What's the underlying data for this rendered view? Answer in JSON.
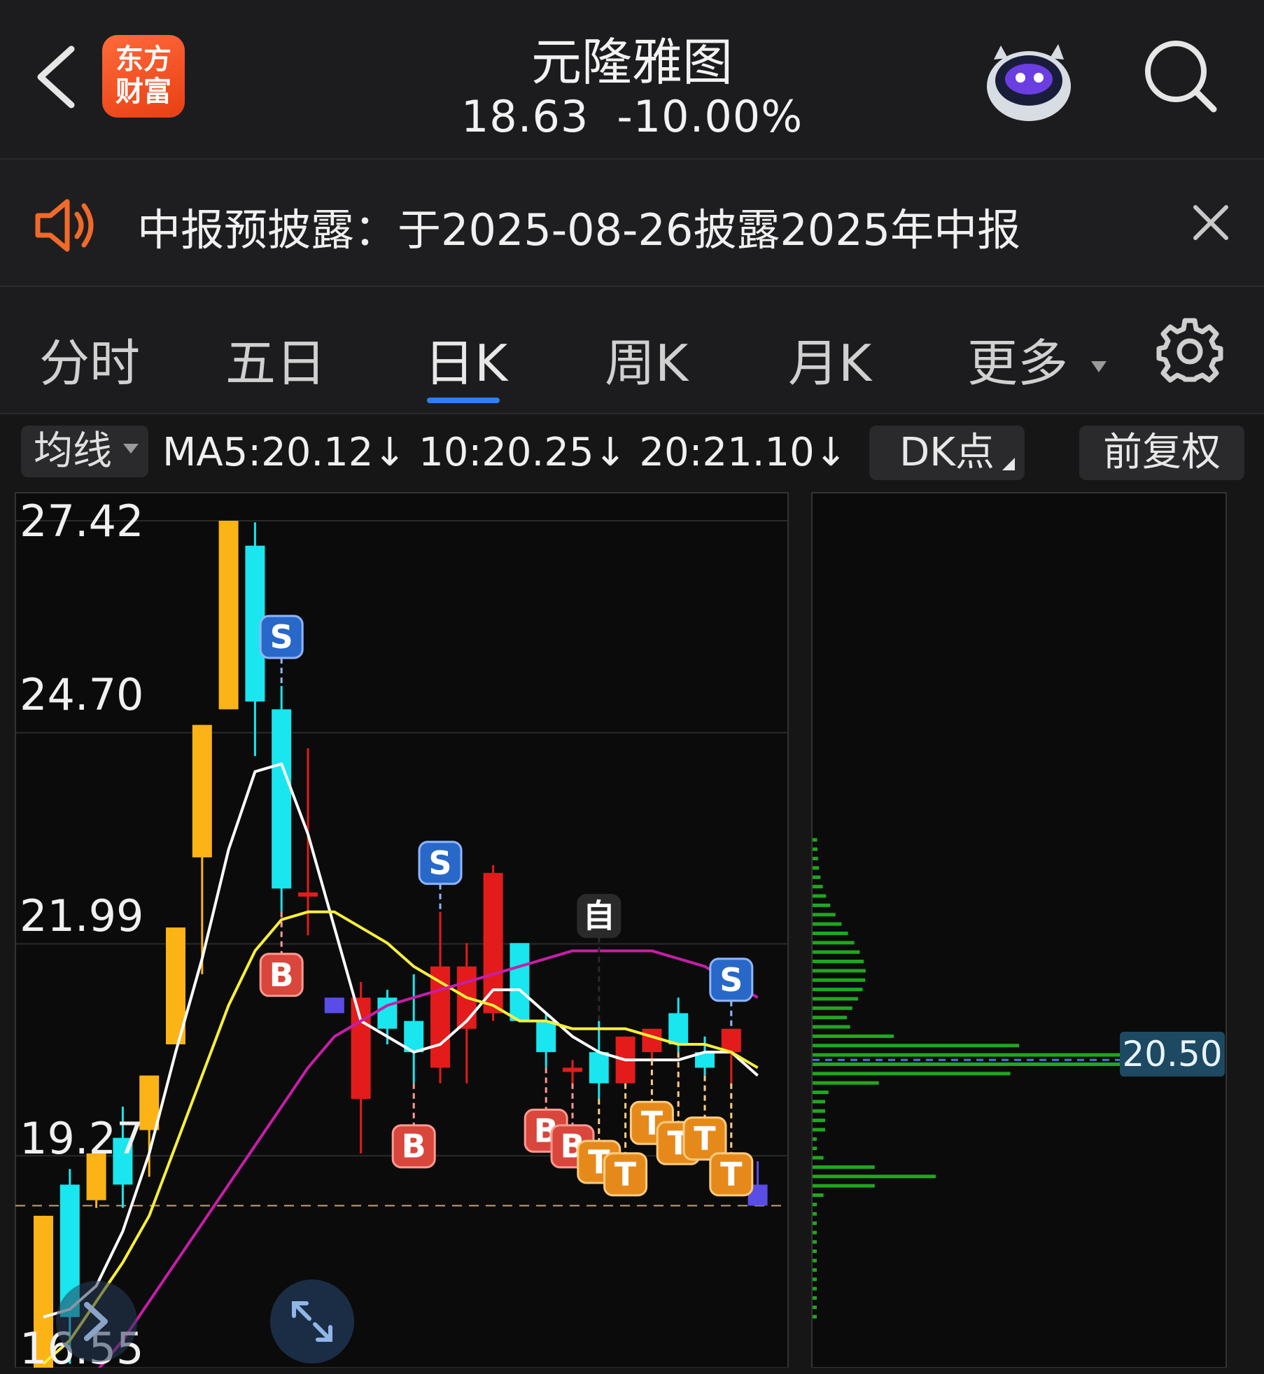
{
  "header": {
    "back_icon": "chevron-left-icon",
    "logo_line1": "东方",
    "logo_line2": "财富",
    "stock_name": "元隆雅图",
    "price": "18.63",
    "change_pct": "-10.00%",
    "mascot_icon": "robot-mascot-icon",
    "search_icon": "search-icon"
  },
  "notice": {
    "icon": "speaker-icon",
    "text": "中报预披露：于2025-08-26披露2025年中报",
    "close_icon": "close-icon"
  },
  "tabs": [
    {
      "label": "分时"
    },
    {
      "label": "五日"
    },
    {
      "label": "日K",
      "active": true
    },
    {
      "label": "周K"
    },
    {
      "label": "月K"
    },
    {
      "label": "更多"
    }
  ],
  "settings_icon": "gear-icon",
  "toolbar": {
    "ma_label": "均线",
    "ma_values": "MA5:20.12↓ 10:20.25↓ 20:21.10↓",
    "dk_label": "DK点",
    "adjust_label": "前复权"
  },
  "chart_data": {
    "type": "candlestick",
    "y_axis_labels": [
      "27.42",
      "24.70",
      "21.99",
      "19.27",
      "16.55"
    ],
    "ylim": [
      16.55,
      27.42
    ],
    "reference_price": 18.63,
    "colors": {
      "up": "#e31b1b",
      "down": "#19e6ee",
      "limit_up": "#fbb316",
      "other": "#5a4de6",
      "ma5": "#ffffff",
      "ma10": "#f6ef3b",
      "ma20": "#c61ea8",
      "volume_profile": "#1fa81e",
      "reference": "#c8a070"
    },
    "candles": [
      {
        "o": 16.4,
        "h": 18.5,
        "l": 16.0,
        "c": 18.5,
        "color": "limit_up"
      },
      {
        "o": 18.9,
        "h": 19.1,
        "l": 16.6,
        "c": 17.2,
        "color": "down"
      },
      {
        "o": 18.7,
        "h": 19.3,
        "l": 18.6,
        "c": 19.3,
        "color": "limit_up"
      },
      {
        "o": 19.5,
        "h": 19.9,
        "l": 18.6,
        "c": 18.9,
        "color": "down"
      },
      {
        "o": 19.6,
        "h": 20.3,
        "l": 19.0,
        "c": 20.3,
        "color": "limit_up"
      },
      {
        "o": 20.7,
        "h": 20.7,
        "l": 20.7,
        "c": 22.2,
        "color": "limit_up"
      },
      {
        "o": 23.1,
        "h": 24.8,
        "l": 21.6,
        "c": 24.8,
        "color": "limit_up"
      },
      {
        "o": 25.0,
        "h": 27.42,
        "l": 25.0,
        "c": 27.42,
        "color": "limit_up"
      },
      {
        "o": 27.1,
        "h": 27.4,
        "l": 24.4,
        "c": 25.1,
        "color": "down"
      },
      {
        "o": 25.0,
        "h": 25.3,
        "l": 22.4,
        "c": 22.7,
        "color": "down"
      },
      {
        "o": 22.65,
        "h": 24.5,
        "l": 22.1,
        "c": 22.65,
        "color": "up"
      },
      {
        "o": 21.3,
        "h": 21.3,
        "l": 21.2,
        "c": 21.1,
        "color": "other"
      },
      {
        "o": 20.0,
        "h": 21.5,
        "l": 19.3,
        "c": 21.3,
        "color": "up"
      },
      {
        "o": 21.3,
        "h": 21.4,
        "l": 20.7,
        "c": 20.9,
        "color": "down"
      },
      {
        "o": 21.0,
        "h": 21.6,
        "l": 20.2,
        "c": 20.6,
        "color": "down"
      },
      {
        "o": 20.4,
        "h": 22.4,
        "l": 20.2,
        "c": 21.7,
        "color": "up"
      },
      {
        "o": 20.9,
        "h": 22.0,
        "l": 20.2,
        "c": 21.7,
        "color": "up"
      },
      {
        "o": 21.1,
        "h": 23.0,
        "l": 21.0,
        "c": 22.9,
        "color": "up"
      },
      {
        "o": 22.0,
        "h": 22.0,
        "l": 21.0,
        "c": 21.0,
        "color": "down"
      },
      {
        "o": 21.0,
        "h": 21.1,
        "l": 20.4,
        "c": 20.6,
        "color": "down"
      },
      {
        "o": 20.4,
        "h": 20.5,
        "l": 20.2,
        "c": 20.4,
        "color": "up"
      },
      {
        "o": 20.6,
        "h": 21.0,
        "l": 20.0,
        "c": 20.2,
        "color": "down"
      },
      {
        "o": 20.2,
        "h": 20.8,
        "l": 20.2,
        "c": 20.8,
        "color": "up"
      },
      {
        "o": 20.6,
        "h": 20.9,
        "l": 20.5,
        "c": 20.9,
        "color": "up"
      },
      {
        "o": 21.1,
        "h": 21.3,
        "l": 20.6,
        "c": 20.7,
        "color": "down"
      },
      {
        "o": 20.6,
        "h": 20.8,
        "l": 20.3,
        "c": 20.4,
        "color": "down"
      },
      {
        "o": 20.6,
        "h": 20.9,
        "l": 20.2,
        "c": 20.9,
        "color": "up"
      },
      {
        "o": 18.63,
        "h": 19.2,
        "l": 18.63,
        "c": 18.9,
        "color": "other"
      }
    ],
    "ma5": [
      17.2,
      17.3,
      17.6,
      18.3,
      19.3,
      20.6,
      21.8,
      23.2,
      24.2,
      24.3,
      23.4,
      22.2,
      21.0,
      20.8,
      20.6,
      20.7,
      21.0,
      21.4,
      21.4,
      21.1,
      20.8,
      20.6,
      20.5,
      20.5,
      20.5,
      20.6,
      20.6,
      20.3
    ],
    "ma10": [
      16.6,
      16.9,
      17.4,
      17.9,
      18.5,
      19.4,
      20.3,
      21.2,
      21.9,
      22.3,
      22.4,
      22.4,
      22.2,
      22.0,
      21.7,
      21.5,
      21.3,
      21.2,
      21.0,
      21.0,
      20.9,
      20.9,
      20.9,
      20.8,
      20.7,
      20.7,
      20.6,
      20.4
    ],
    "ma20": [
      15.8,
      16.1,
      16.5,
      16.9,
      17.4,
      17.9,
      18.4,
      18.9,
      19.4,
      19.9,
      20.4,
      20.8,
      21.0,
      21.2,
      21.3,
      21.4,
      21.5,
      21.6,
      21.7,
      21.8,
      21.9,
      21.9,
      21.9,
      21.9,
      21.8,
      21.7,
      21.5,
      21.3
    ],
    "signals": [
      {
        "index": 9,
        "label": "S",
        "type": "sell"
      },
      {
        "index": 9,
        "label": "B",
        "type": "buy"
      },
      {
        "index": 15,
        "label": "S",
        "type": "sell"
      },
      {
        "index": 14,
        "label": "B",
        "type": "buy"
      },
      {
        "index": 19,
        "label": "B",
        "type": "buy"
      },
      {
        "index": 20,
        "label": "B",
        "type": "buy"
      },
      {
        "index": 21,
        "label": "T",
        "type": "t"
      },
      {
        "index": 22,
        "label": "T",
        "type": "t"
      },
      {
        "index": 23,
        "label": "T",
        "type": "t"
      },
      {
        "index": 24,
        "label": "T",
        "type": "t"
      },
      {
        "index": 25,
        "label": "T",
        "type": "t"
      },
      {
        "index": 26,
        "label": "T",
        "type": "t"
      },
      {
        "index": 26,
        "label": "S",
        "type": "sell"
      },
      {
        "index": 21,
        "label": "自",
        "type": "self"
      }
    ],
    "volume_profile_label": "20.50",
    "volume_profile_price": 20.5
  },
  "fab_icons": {
    "left": "chevron-right-icon",
    "expand": "expand-arrows-icon"
  }
}
